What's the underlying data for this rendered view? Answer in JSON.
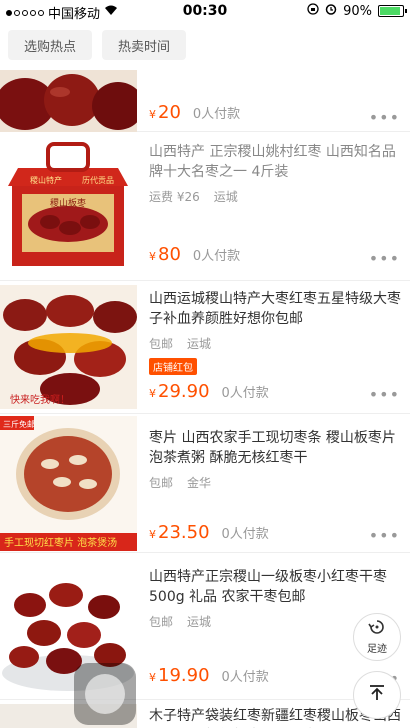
{
  "status_bar": {
    "carrier": "中国移动",
    "time": "00:30",
    "battery": "90%",
    "battery_level": 0.9
  },
  "filters": [
    {
      "label": "选购热点"
    },
    {
      "label": "热卖时间"
    }
  ],
  "items": [
    {
      "title": "",
      "meta_left": "",
      "meta_right": "",
      "currency": "¥",
      "price": "20",
      "paid": "0人付款",
      "more": "•••"
    },
    {
      "title": "山西特产 正宗稷山姚村红枣 山西知名品牌十大名枣之一 4斤装",
      "meta_left": "运费 ¥26",
      "meta_right": "运城",
      "currency": "¥",
      "price": "80",
      "paid": "0人付款",
      "more": "•••"
    },
    {
      "title": "山西运城稷山特产大枣红枣五星特级大枣子补血养颜胜好想你包邮",
      "meta_left": "包邮",
      "meta_right": "运城",
      "tag": "店铺红包",
      "currency": "¥",
      "price": "29.90",
      "paid": "0人付款",
      "more": "•••"
    },
    {
      "title": "枣片 山西农家手工现切枣条 稷山板枣片 泡茶煮粥 酥脆无核红枣干",
      "meta_left": "包邮",
      "meta_right": "金华",
      "currency": "¥",
      "price": "23.50",
      "paid": "0人付款",
      "more": "•••"
    },
    {
      "title": "山西特产正宗稷山一级板枣小红枣干枣500g 礼品 农家干枣包邮",
      "meta_left": "包邮",
      "meta_right": "运城",
      "currency": "¥",
      "price": "19.90",
      "paid": "0人付款",
      "more": "•••"
    },
    {
      "title": "木子特产袋装红枣新疆红枣稷山板枣山西运城稷山特级红枣价识零食"
    }
  ],
  "image_texts": {
    "box_label": "稷山板枣",
    "box_top_left": "稷山特产",
    "box_top_right": "历代贡品",
    "banner_promo": "快来吃我啊！",
    "banner_sticker": "三斤免邮",
    "banner_title": "手工现切红枣片 泡茶煲汤"
  },
  "fab": {
    "footprint_label": "足迹"
  }
}
